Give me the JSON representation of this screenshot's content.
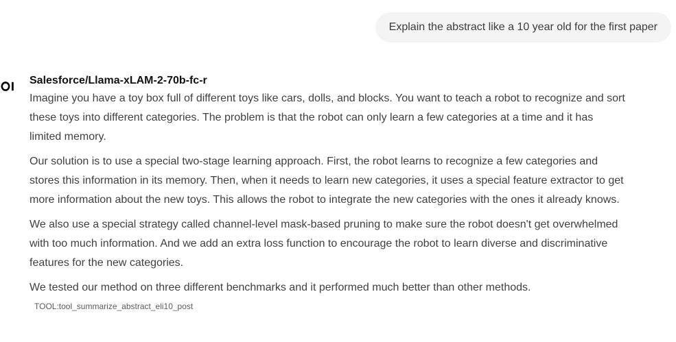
{
  "user_message": {
    "text": "Explain the abstract like a 10 year old for the first paper"
  },
  "assistant": {
    "avatar_icon": "ol-logo-icon",
    "model_name": "Salesforce/Llama-xLAM-2-70b-fc-r",
    "paragraphs": [
      {
        "lines": [
          "Imagine you have a toy box full of different toys like cars, dolls, and blocks. You want to teach a robot to recognize and sort",
          "these toys into different categories. The problem is that the robot can only learn a few categories at a time and it has",
          "limited memory."
        ]
      },
      {
        "lines": [
          "Our solution is to use a special two-stage learning approach. First, the robot learns to recognize a few categories and",
          "stores this information in its memory. Then, when it needs to learn new categories, it uses a special feature extractor to get",
          "more information about the new toys. This allows the robot to integrate the new categories with the ones it already knows."
        ]
      },
      {
        "lines": [
          "We also use a special strategy called channel-level mask-based pruning to make sure the robot doesn't get overwhelmed",
          "with too much information. And we add an extra loss function to encourage the robot to learn diverse and discriminative",
          "features for the new categories."
        ]
      },
      {
        "lines": [
          "We tested our method on three different benchmarks and it performed much better than other methods."
        ]
      }
    ],
    "tool_tag": "TOOL:tool_summarize_abstract_eli10_post"
  }
}
